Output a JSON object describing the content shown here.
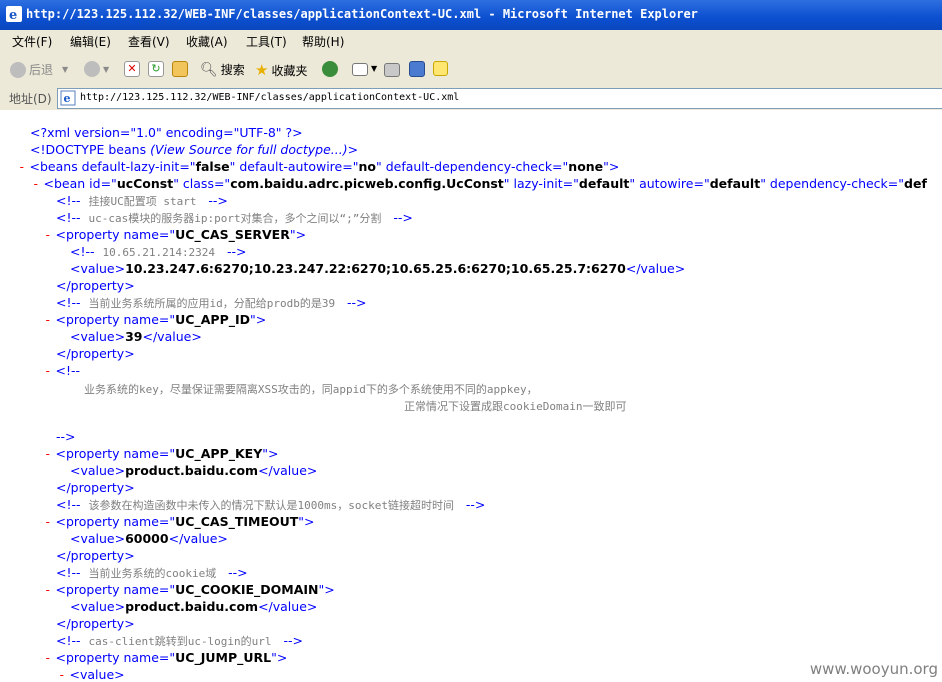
{
  "window": {
    "title": "http://123.125.112.32/WEB-INF/classes/applicationContext-UC.xml - Microsoft Internet Explorer"
  },
  "menu": [
    "文件(F)",
    "编辑(E)",
    "查看(V)",
    "收藏(A)",
    "工具(T)",
    "帮助(H)"
  ],
  "toolbar": {
    "back": "后退",
    "search": "搜索",
    "favorites": "收藏夹"
  },
  "address": {
    "label": "地址(D)",
    "url": "http://123.125.112.32/WEB-INF/classes/applicationContext-UC.xml"
  },
  "xml": {
    "decl": "<?xml version=\"1.0\" encoding=\"UTF-8\" ?>",
    "doctype_open": "<!DOCTYPE beans ",
    "doctype_link": "(View Source for full doctype...)",
    "doctype_close": ">",
    "minus": "-",
    "beans_open": "<beans default-lazy-init=\"",
    "beans_lazy": "false",
    "beans_mid1": "\" default-autowire=\"",
    "beans_autowire": "no",
    "beans_mid2": "\" default-dependency-check=\"",
    "beans_dep": "none",
    "beans_close": "\">",
    "bean_tag": "<bean id=\"",
    "bean_id": "ucConst",
    "bean_class_attr": "\" class=\"",
    "bean_class": "com.baidu.adrc.picweb.config.UcConst",
    "bean_lazy_attr": "\" lazy-init=\"",
    "bean_lazy": "default",
    "bean_autowire_attr": "\" autowire=\"",
    "bean_autowire": "default",
    "bean_dep_attr": "\" dependency-check=\"",
    "bean_dep": "def",
    "comment_open": "<!--",
    "comment_close": "-->",
    "c1": "挂接UC配置项 start",
    "c2": "uc-cas模块的服务器ip:port对集合，多个之间以“;”分割",
    "prop_open": "<property name=\"",
    "prop_close": "\">",
    "prop_end": "</property>",
    "value_open": "<value>",
    "value_close": "</value>",
    "p1_name": "UC_CAS_SERVER",
    "p1_comment": "10.65.21.214:2324",
    "p1_value": "10.23.247.6:6270;10.23.247.22:6270;10.65.25.6:6270;10.65.25.7:6270",
    "c3": "当前业务系统所属的应用id，分配给prodb的是39",
    "p2_name": "UC_APP_ID",
    "p2_value": "39",
    "c4_line1": "业务系统的key，尽量保证需要隔离XSS攻击的，同appid下的多个系统使用不同的appkey，",
    "c4_line2": "正常情况下设置成跟cookieDomain一致即可",
    "p3_name": "UC_APP_KEY",
    "p3_value": "product.baidu.com",
    "c5": "该参数在构造函数中未传入的情况下默认是1000ms，socket链接超时时间",
    "p4_name": "UC_CAS_TIMEOUT",
    "p4_value": "60000",
    "c6": "当前业务系统的cookie域",
    "p5_name": "UC_COOKIE_DOMAIN",
    "p5_value": "product.baidu.com",
    "c7": "cas-client跳转到uc-login的url",
    "p6_name": "UC_JUMP_URL"
  },
  "watermark": "www.wooyun.org"
}
